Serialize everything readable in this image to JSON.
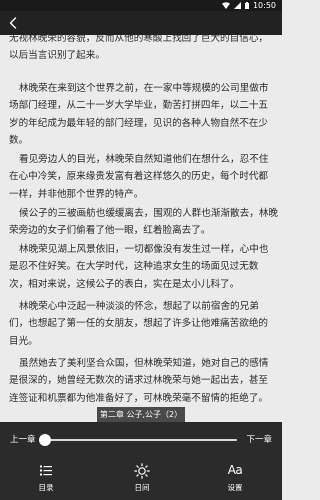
{
  "status_bar": {
    "time": "10:50"
  },
  "paragraphs": [
    {
      "lines": [
        "无视林晚荣的容貌，反而从他的寒酸上找回了巨大的自信心，",
        "以后当言识别了起来。"
      ]
    },
    {
      "lines": [
        "林晚荣在来到这个世界之前，在一家中等规模的公司里做市",
        "场部门经理，从二十一岁大学毕业，勤苦打拼四年，以二十五",
        "岁的年纪成为最年轻的部门经理，见识的各种人物自然不在少",
        "数。"
      ]
    },
    {
      "lines": [
        "看见旁边人的目光，林晚荣自然知道他们在想什么，忍不住",
        "在心中冷笑，原来缘贵发富有着这样悠久的历史，每个时代都",
        "一样，并非他那个世界的特产。"
      ]
    },
    {
      "lines": [
        "候公子的三被画舫也缓缓离去，围观的人群也渐渐散去，林晚",
        "荣旁边的女子们偷看了他一眼，红着脸离去了。"
      ]
    },
    {
      "lines": [
        "林晚荣见湖上风景依旧，一切都像没有发生过一样，心中也",
        "是忍不住好笑。在大学时代，这种追求女生的场面见过无数",
        "次，相对来说，这候公子的表白，实在是太小儿科了。"
      ]
    },
    {
      "lines": [
        "林晚荣心中泛起一种淡淡的怀念，想起了以前宿舍的兄弟",
        "们，也想起了第一任的女朋友，想起了许多让他难痛苦欲绝的",
        "目光。"
      ]
    },
    {
      "lines": [
        "虽然她去了美利坚合众国，但林晚荣知道，她对自己的感情",
        "是很深的，她曾经无数次的请求过林晚荣与她一起出去，甚至",
        "连签证和机票都为他准备好了，可林晚荣毫不留情的拒绝了。"
      ]
    }
  ],
  "chapter_tip": "第二章 公子,公子（2）",
  "controls": {
    "prev_chapter": "上一章",
    "next_chapter": "下一章",
    "progress": 0.0,
    "tabs": [
      {
        "label": "目录",
        "icon": "list-icon"
      },
      {
        "label": "日间",
        "icon": "sun-icon"
      },
      {
        "label": "设置",
        "icon": "font-settings-icon"
      }
    ]
  }
}
